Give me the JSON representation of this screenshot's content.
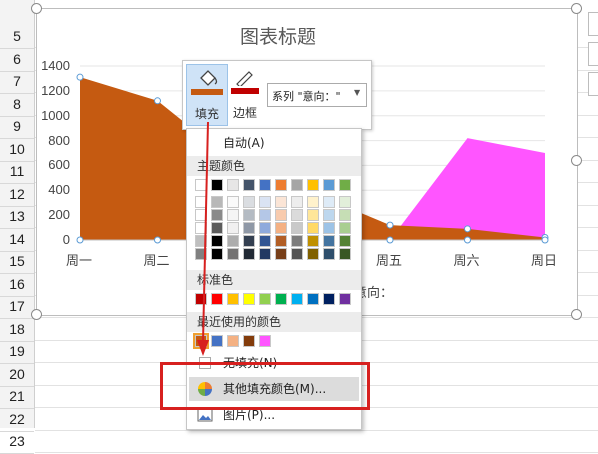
{
  "sheet": {
    "row_numbers": [
      "5",
      "6",
      "7",
      "8",
      "9",
      "10",
      "11",
      "12",
      "13",
      "14",
      "15",
      "16",
      "17",
      "18",
      "19",
      "20",
      "21",
      "22",
      "23"
    ]
  },
  "chart": {
    "title": "图表标题",
    "y_ticks": [
      "1400",
      "1200",
      "1000",
      "800",
      "600",
      "400",
      "200",
      "0"
    ],
    "x_ticks": [
      "周一",
      "周二",
      "周三",
      "周四",
      "周五",
      "周六",
      "周日"
    ],
    "partial_legend_text": "意向："
  },
  "chart_data": {
    "type": "area",
    "title": "图表标题",
    "categories": [
      "周一",
      "周二",
      "周三",
      "周四",
      "周五",
      "周六",
      "周日"
    ],
    "ylim": [
      0,
      1400
    ],
    "series": [
      {
        "name": "意向：",
        "color": "#ff55ff",
        "values": [
          0,
          0,
          0,
          0,
          0,
          820,
          700
        ]
      },
      {
        "name": "",
        "color": "#4472c4",
        "values": [
          0,
          0,
          0,
          320,
          100,
          40,
          0
        ]
      },
      {
        "color": "#c55a11",
        "values": [
          1310,
          1120,
          620,
          380,
          120,
          90,
          20
        ]
      }
    ]
  },
  "toolbar": {
    "fill_label": "填充",
    "border_label": "边框",
    "series_value": "系列 \"意向：\""
  },
  "menu": {
    "auto_label": "自动(A)",
    "theme_colors_header": "主题颜色",
    "standard_colors_header": "标准色",
    "recent_colors_header": "最近使用的颜色",
    "no_fill_label": "无填充(N)",
    "more_colors_label": "其他填充颜色(M)...",
    "picture_label": "图片(P)...",
    "theme_row": [
      "#ffffff",
      "#000000",
      "#e7e6e6",
      "#44546a",
      "#4472c4",
      "#ed7d31",
      "#a5a5a5",
      "#ffc000",
      "#5b9bd5",
      "#70ad47"
    ],
    "standard_colors": [
      "#c00000",
      "#ff0000",
      "#ffc000",
      "#ffff00",
      "#92d050",
      "#00b050",
      "#00b0f0",
      "#0070c0",
      "#002060",
      "#7030a0"
    ],
    "recent_colors": [
      "#c55a11",
      "#4472c4",
      "#f4b183",
      "#833c0b",
      "#ff55ff"
    ]
  }
}
